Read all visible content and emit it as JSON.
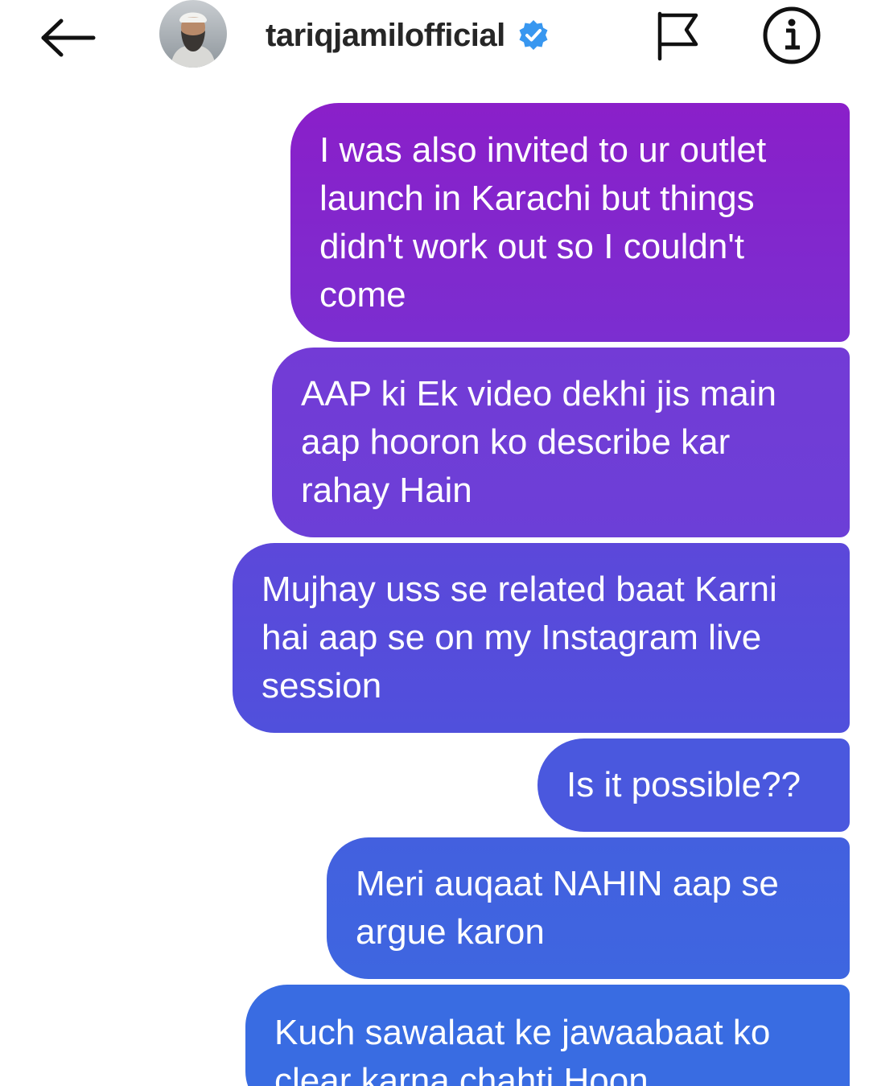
{
  "header": {
    "back_icon": "arrow-left-icon",
    "avatar_icon": "profile-avatar",
    "username": "tariqjamilofficial",
    "verified_icon": "verified-badge-icon",
    "verified_color": "#3897f0",
    "flag_icon": "flag-icon",
    "info_icon": "info-icon"
  },
  "messages": [
    {
      "text": "I was also invited to ur outlet launch in Karachi but things didn't work out so I couldn't come",
      "color": "#8a1fc9"
    },
    {
      "text": "AAP ki Ek video dekhi jis main aap hooron ko describe kar rahay Hain",
      "color": "#733bd6"
    },
    {
      "text": "Mujhay uss se related baat Karni hai aap se on my Instagram live session",
      "color": "#5c48da"
    },
    {
      "text": "Is it possible??",
      "color": "#4a58de"
    },
    {
      "text": "Meri auqaat NAHIN aap se argue karon",
      "color": "#4360df"
    },
    {
      "text": "Kuch sawalaat ke jawaabaat ko clear karna chahti Hoon",
      "color": "#396ce2"
    }
  ]
}
